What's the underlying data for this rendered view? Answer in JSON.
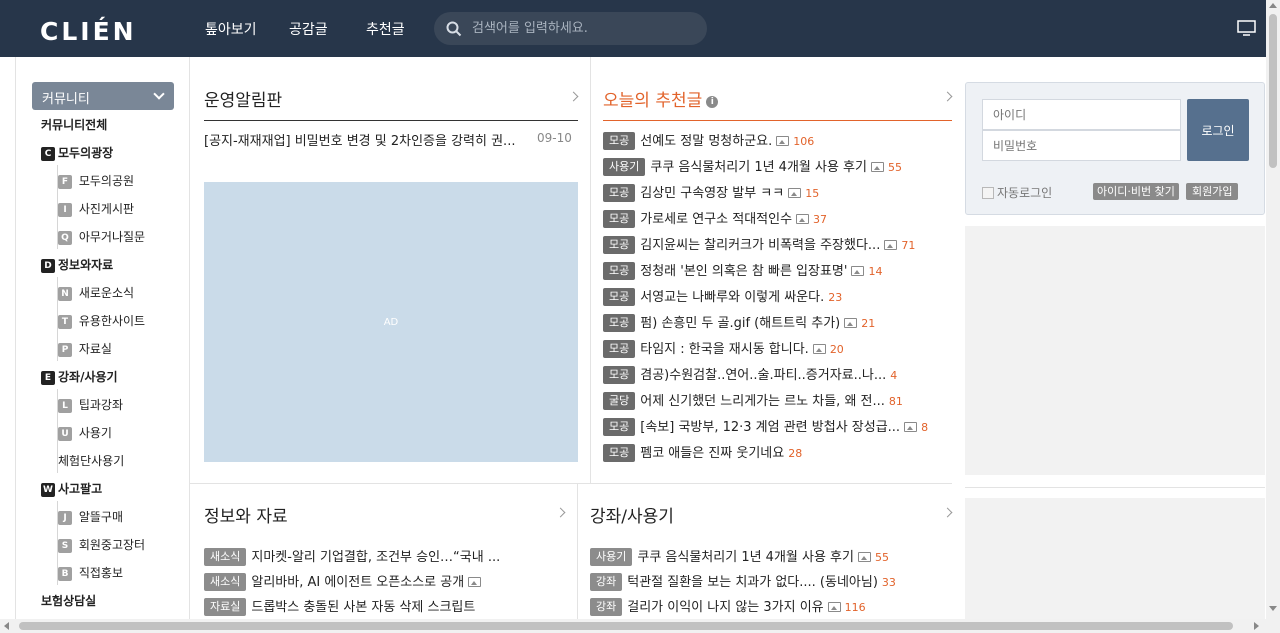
{
  "header": {
    "logo": "CLIÉN",
    "nav": [
      "톺아보기",
      "공감글",
      "추천글"
    ],
    "search_placeholder": "검색어를 입력하세요."
  },
  "sidebar": {
    "heading": "커뮤니티",
    "items": [
      {
        "label": "커뮤니티전체",
        "badge": ""
      },
      {
        "label": "모두의광장",
        "badge": "C"
      },
      {
        "label": "모두의공원",
        "badge": "F"
      },
      {
        "label": "사진게시판",
        "badge": "I"
      },
      {
        "label": "아무거나질문",
        "badge": "Q"
      },
      {
        "label": "정보와자료",
        "badge": "D"
      },
      {
        "label": "새로운소식",
        "badge": "N"
      },
      {
        "label": "유용한사이트",
        "badge": "T"
      },
      {
        "label": "자료실",
        "badge": "P"
      },
      {
        "label": "강좌/사용기",
        "badge": "E"
      },
      {
        "label": "팁과강좌",
        "badge": "L"
      },
      {
        "label": "사용기",
        "badge": "U"
      },
      {
        "label": "체험단사용기",
        "badge": ""
      },
      {
        "label": "사고팔고",
        "badge": "W"
      },
      {
        "label": "알뜰구매",
        "badge": "J"
      },
      {
        "label": "회원중고장터",
        "badge": "S"
      },
      {
        "label": "직접홍보",
        "badge": "B"
      },
      {
        "label": "보험상담실",
        "badge": ""
      }
    ]
  },
  "notice": {
    "title": "운영알림판",
    "post": "[공지-재재재업] 비밀번호 변경 및 2차인증을 강력히 권...",
    "date": "09-10",
    "ad_label": "AD"
  },
  "recommended": {
    "title": "오늘의 추천글",
    "info_icon": "i",
    "posts": [
      {
        "tag": "모공",
        "title": "선예도 정말 멍청하군요.",
        "img": true,
        "count": "106"
      },
      {
        "tag": "사용기",
        "title": "쿠쿠 음식물처리기 1년 4개월 사용 후기",
        "img": true,
        "count": "55"
      },
      {
        "tag": "모공",
        "title": "김상민 구속영장 발부 ㅋㅋ",
        "img": true,
        "count": "15"
      },
      {
        "tag": "모공",
        "title": "가로세로 연구소 적대적인수",
        "img": true,
        "count": "37"
      },
      {
        "tag": "모공",
        "title": "김지윤씨는 찰리커크가 비폭력을 주장했다...",
        "img": true,
        "count": "71"
      },
      {
        "tag": "모공",
        "title": "정청래 '본인 의혹은 참 빠른 입장표명'",
        "img": true,
        "count": "14"
      },
      {
        "tag": "모공",
        "title": "서영교는 나빠루와 이렇게 싸운다.",
        "img": false,
        "count": "23"
      },
      {
        "tag": "모공",
        "title": "펌) 손흥민 두 골.gif (해트트릭 추가)",
        "img": true,
        "count": "21"
      },
      {
        "tag": "모공",
        "title": "타임지 : 한국을 재시동 합니다.",
        "img": true,
        "count": "20"
      },
      {
        "tag": "모공",
        "title": "겸공)수원검찰..연어..술.파티..증거자료..나...",
        "img": false,
        "count": "4"
      },
      {
        "tag": "굴당",
        "title": "어제 신기했던 느리게가는 르노 차들, 왜 전...",
        "img": false,
        "count": "81"
      },
      {
        "tag": "모공",
        "title": "[속보] 국방부, 12·3 계엄 관련 방첩사 장성급...",
        "img": true,
        "count": "8"
      },
      {
        "tag": "모공",
        "title": "펨코 애들은 진짜 웃기네요",
        "img": false,
        "count": "28"
      }
    ]
  },
  "info_section": {
    "title": "정보와 자료",
    "posts": [
      {
        "tag": "새소식",
        "title": "지마켓-알리 기업결합, 조건부 승인…“국내 ...",
        "img": false
      },
      {
        "tag": "새소식",
        "title": "알리바바, AI 에이전트 오픈소스로 공개",
        "img": true
      },
      {
        "tag": "자료실",
        "title": "드롭박스 충돌된 사본 자동 삭제 스크립트",
        "img": false
      }
    ]
  },
  "review_section": {
    "title": "강좌/사용기",
    "posts": [
      {
        "tag": "사용기",
        "title": "쿠쿠 음식물처리기 1년 4개월 사용 후기",
        "img": true,
        "count": "55"
      },
      {
        "tag": "강좌",
        "title": "턱관절 질환을 보는 치과가 없다.... (동네아님)",
        "img": false,
        "count": "33"
      },
      {
        "tag": "강좌",
        "title": "걸리가 이익이 나지 않는 3가지 이유",
        "img": true,
        "count": "116"
      }
    ]
  },
  "login": {
    "id_placeholder": "아이디",
    "pw_placeholder": "비밀번호",
    "login_button": "로그인",
    "auto_login": "자동로그인",
    "find_button": "아이디·비번 찾기",
    "signup_button": "회원가입"
  }
}
